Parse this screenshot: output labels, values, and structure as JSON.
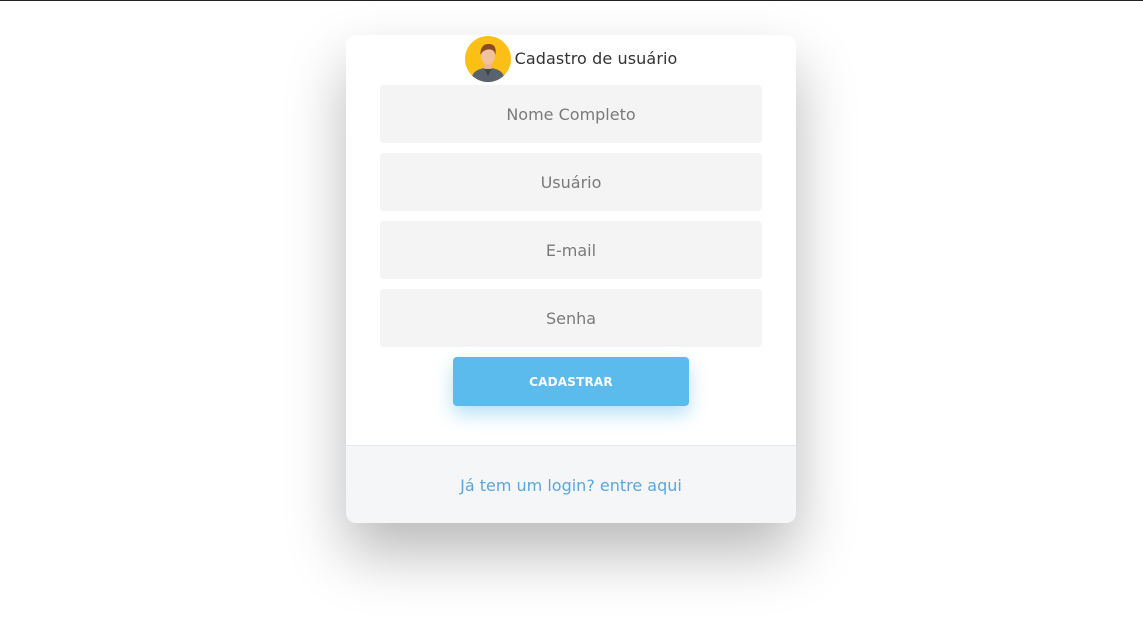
{
  "header": {
    "title": "Cadastro de usuário",
    "avatar_icon": "user-avatar-icon"
  },
  "form": {
    "fields": [
      {
        "name": "nome",
        "placeholder": "Nome Completo",
        "value": ""
      },
      {
        "name": "usuario",
        "placeholder": "Usuário",
        "value": ""
      },
      {
        "name": "email",
        "placeholder": "E-mail",
        "value": ""
      },
      {
        "name": "senha",
        "placeholder": "Senha",
        "value": ""
      }
    ],
    "submit_label": "CADASTRAR"
  },
  "footer": {
    "login_link": "Já tem um login? entre aqui"
  },
  "colors": {
    "accent": "#5bbbec",
    "link": "#5aa7e0",
    "field_bg": "#f4f4f4",
    "footer_bg": "#f5f6f7",
    "avatar_bg": "#fbbf16"
  }
}
